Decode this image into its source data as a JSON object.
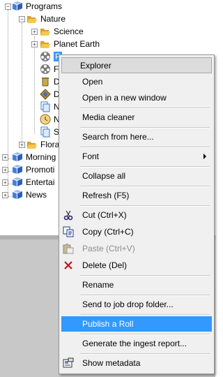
{
  "tree": {
    "programs": "Programs",
    "nature": "Nature",
    "science": "Science",
    "planet_earth": "Planet Earth",
    "selected_item": "P",
    "child_f": "F",
    "child_d1": "D",
    "child_d2": "D",
    "child_n1": "N",
    "child_n2": "N",
    "child_s": "S",
    "flora": "Flora",
    "morning": "Morning",
    "promotions": "Promoti",
    "entertainment": "Entertai",
    "news": "News"
  },
  "menu": {
    "header": "Explorer",
    "open": "Open",
    "open_new_window": "Open in a new window",
    "media_cleaner": "Media cleaner",
    "search_from_here": "Search from here...",
    "font": "Font",
    "collapse_all": "Collapse all",
    "refresh": "Refresh (F5)",
    "cut": "Cut (Ctrl+X)",
    "copy": "Copy (Ctrl+C)",
    "paste": "Paste (Ctrl+V)",
    "delete": "Delete (Del)",
    "rename": "Rename",
    "send_to_job": "Send to job drop folder...",
    "publish_roll": "Publish a Roll",
    "generate_ingest": "Generate the ingest report...",
    "show_metadata": "Show metadata"
  }
}
